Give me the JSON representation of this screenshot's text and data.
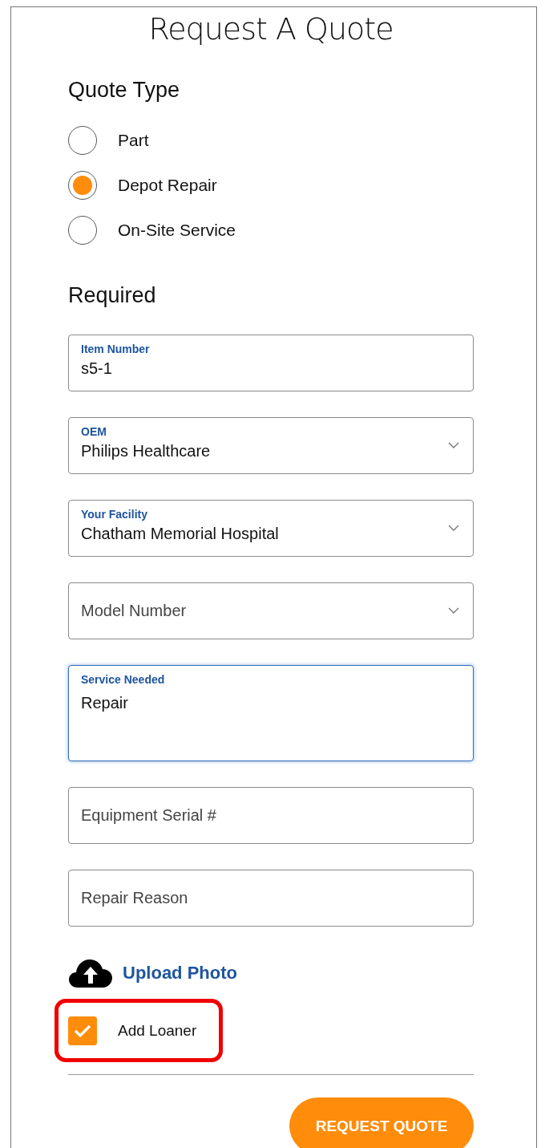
{
  "title": "Request A Quote",
  "quote_type": {
    "heading": "Quote Type",
    "options": [
      {
        "label": "Part",
        "selected": false
      },
      {
        "label": "Depot Repair",
        "selected": true
      },
      {
        "label": "On-Site Service",
        "selected": false
      }
    ]
  },
  "required": {
    "heading": "Required",
    "fields": [
      {
        "kind": "input",
        "label": "Item Number",
        "value": "s5-1",
        "focused": false
      },
      {
        "kind": "select",
        "label": "OEM",
        "value": "Philips Healthcare",
        "focused": false
      },
      {
        "kind": "select",
        "label": "Your Facility",
        "value": "Chatham Memorial Hospital",
        "focused": false
      },
      {
        "kind": "select",
        "placeholder": "Model Number",
        "focused": false
      },
      {
        "kind": "textarea",
        "label": "Service Needed",
        "value": "Repair",
        "focused": true
      },
      {
        "kind": "input",
        "placeholder": "Equipment Serial #",
        "focused": false
      },
      {
        "kind": "input",
        "placeholder": "Repair Reason",
        "focused": false
      }
    ]
  },
  "upload": {
    "label": "Upload Photo"
  },
  "loaner": {
    "label": "Add Loaner",
    "checked": true,
    "highlighted": true
  },
  "submit": {
    "label": "REQUEST QUOTE"
  }
}
